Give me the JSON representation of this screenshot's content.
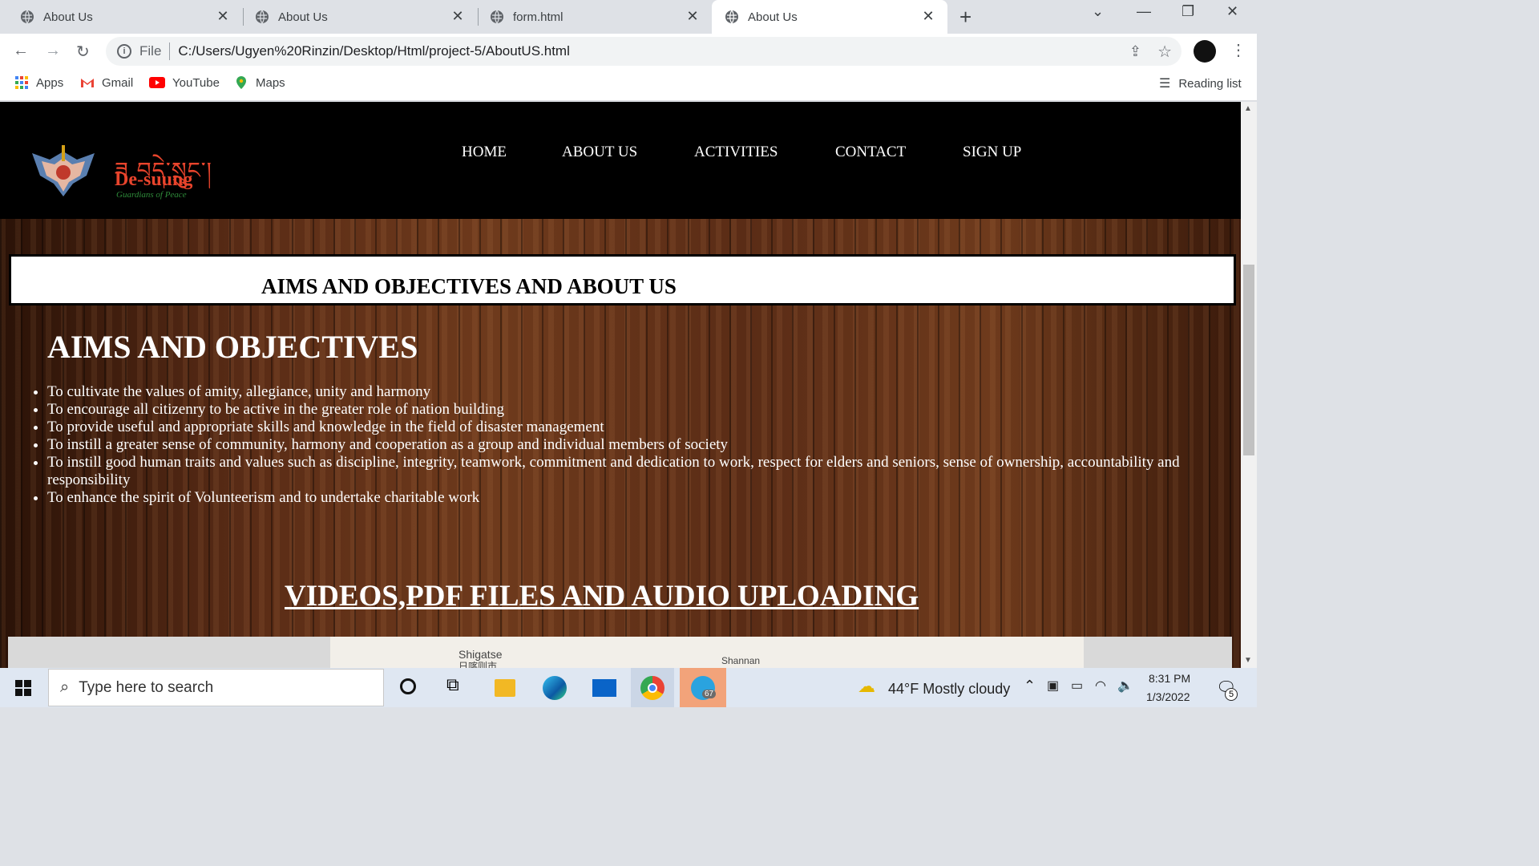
{
  "browser": {
    "tabs": [
      {
        "title": "About Us",
        "active": false
      },
      {
        "title": "About Us",
        "active": false
      },
      {
        "title": "form.html",
        "active": false
      },
      {
        "title": "About Us",
        "active": true
      }
    ],
    "address": {
      "scheme_label": "File",
      "url": "C:/Users/Ugyen%20Rinzin/Desktop/Html/project-5/AboutUS.html"
    },
    "bookmarks": [
      "Apps",
      "Gmail",
      "YouTube",
      "Maps"
    ],
    "reading_list": "Reading list"
  },
  "site": {
    "logo": {
      "tibetan": "ཟ བདེ་སྲུང་།",
      "name": "De-suung",
      "tagline": "Guardians of Peace"
    },
    "nav": [
      "HOME",
      "ABOUT US",
      "ACTIVITIES",
      "CONTACT",
      "SIGN UP"
    ],
    "banner_title": "AIMS AND OBJECTIVES AND ABOUT US",
    "section_title": "AIMS AND OBJECTIVES",
    "objectives": [
      "To cultivate the values of amity, allegiance, unity and harmony",
      "To encourage all citizenry to be active in the greater role of nation building",
      "To provide useful and appropriate skills and knowledge in the field of disaster management",
      "To instill a greater sense of community, harmony and cooperation as a group and individual members of society",
      "To instill good human traits and values such as discipline, integrity, teamwork, commitment and dedication to work, respect for elders and seniors, sense of ownership, accountability and responsibility",
      "To enhance the spirit of Volunteerism and to undertake charitable work"
    ],
    "uploads_heading": "VIDEOS,PDF FILES AND AUDIO UPLOADING",
    "map_labels": [
      "Shigatse",
      "日喀则市",
      "Shannan"
    ]
  },
  "taskbar": {
    "search_placeholder": "Type here to search",
    "weather": "44°F  Mostly cloudy",
    "time": "8:31 PM",
    "date": "1/3/2022",
    "telegram_badge": "67",
    "notif_count": "5"
  }
}
